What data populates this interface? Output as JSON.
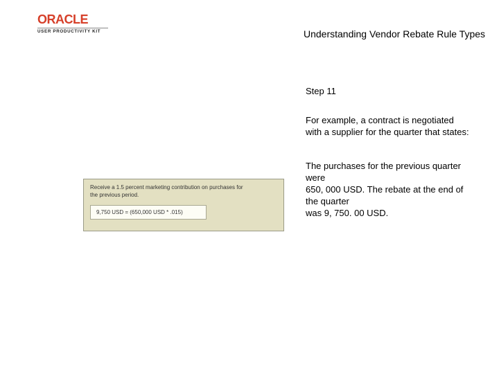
{
  "header": {
    "brand": "ORACLE",
    "brand_sub": "USER PRODUCTIVITY KIT",
    "title": "Understanding Vendor Rebate Rule Types"
  },
  "content": {
    "step_label": "Step 11",
    "para1": "For example, a contract is negotiated with a supplier for the quarter that states:",
    "para2_line1": "The purchases for the previous quarter were",
    "para2_line2": "650, 000 USD. The rebate at the end of the quarter",
    "para2_line3": "was 9, 750. 00 USD."
  },
  "figure": {
    "desc_line1": "Receive a 1.5 percent marketing contribution on purchases for",
    "desc_line2": "the previous period.",
    "formula": "9,750 USD = (650,000 USD * .015)"
  }
}
